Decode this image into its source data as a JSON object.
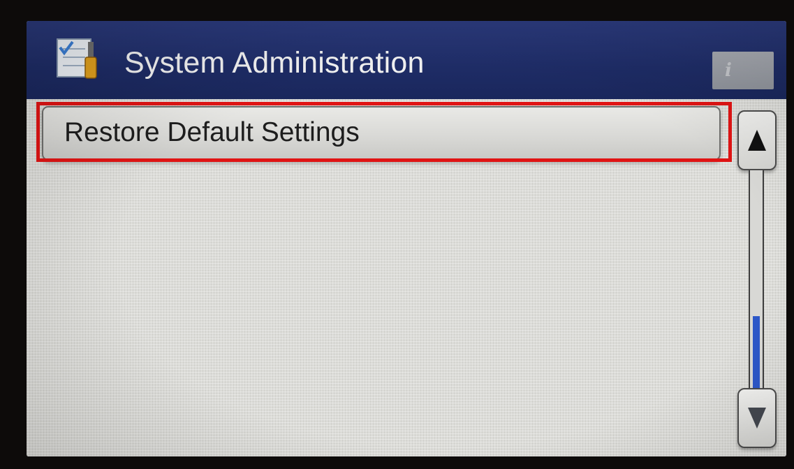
{
  "window": {
    "title": "System Administration",
    "title_icon": "system-admin-tools-icon"
  },
  "info_button": {
    "icon": "info-icon",
    "glyph": "i"
  },
  "menu": {
    "items": [
      {
        "label": "Restore Default Settings",
        "highlighted": true
      }
    ]
  },
  "scrollbar": {
    "up_icon": "arrow-up-icon",
    "down_icon": "arrow-down-icon",
    "position": 1.0,
    "visible_fraction": 0.33
  },
  "colors": {
    "title_bar": "#1e2c66",
    "highlight": "#e01414",
    "scroll_thumb": "#2c57c8"
  }
}
